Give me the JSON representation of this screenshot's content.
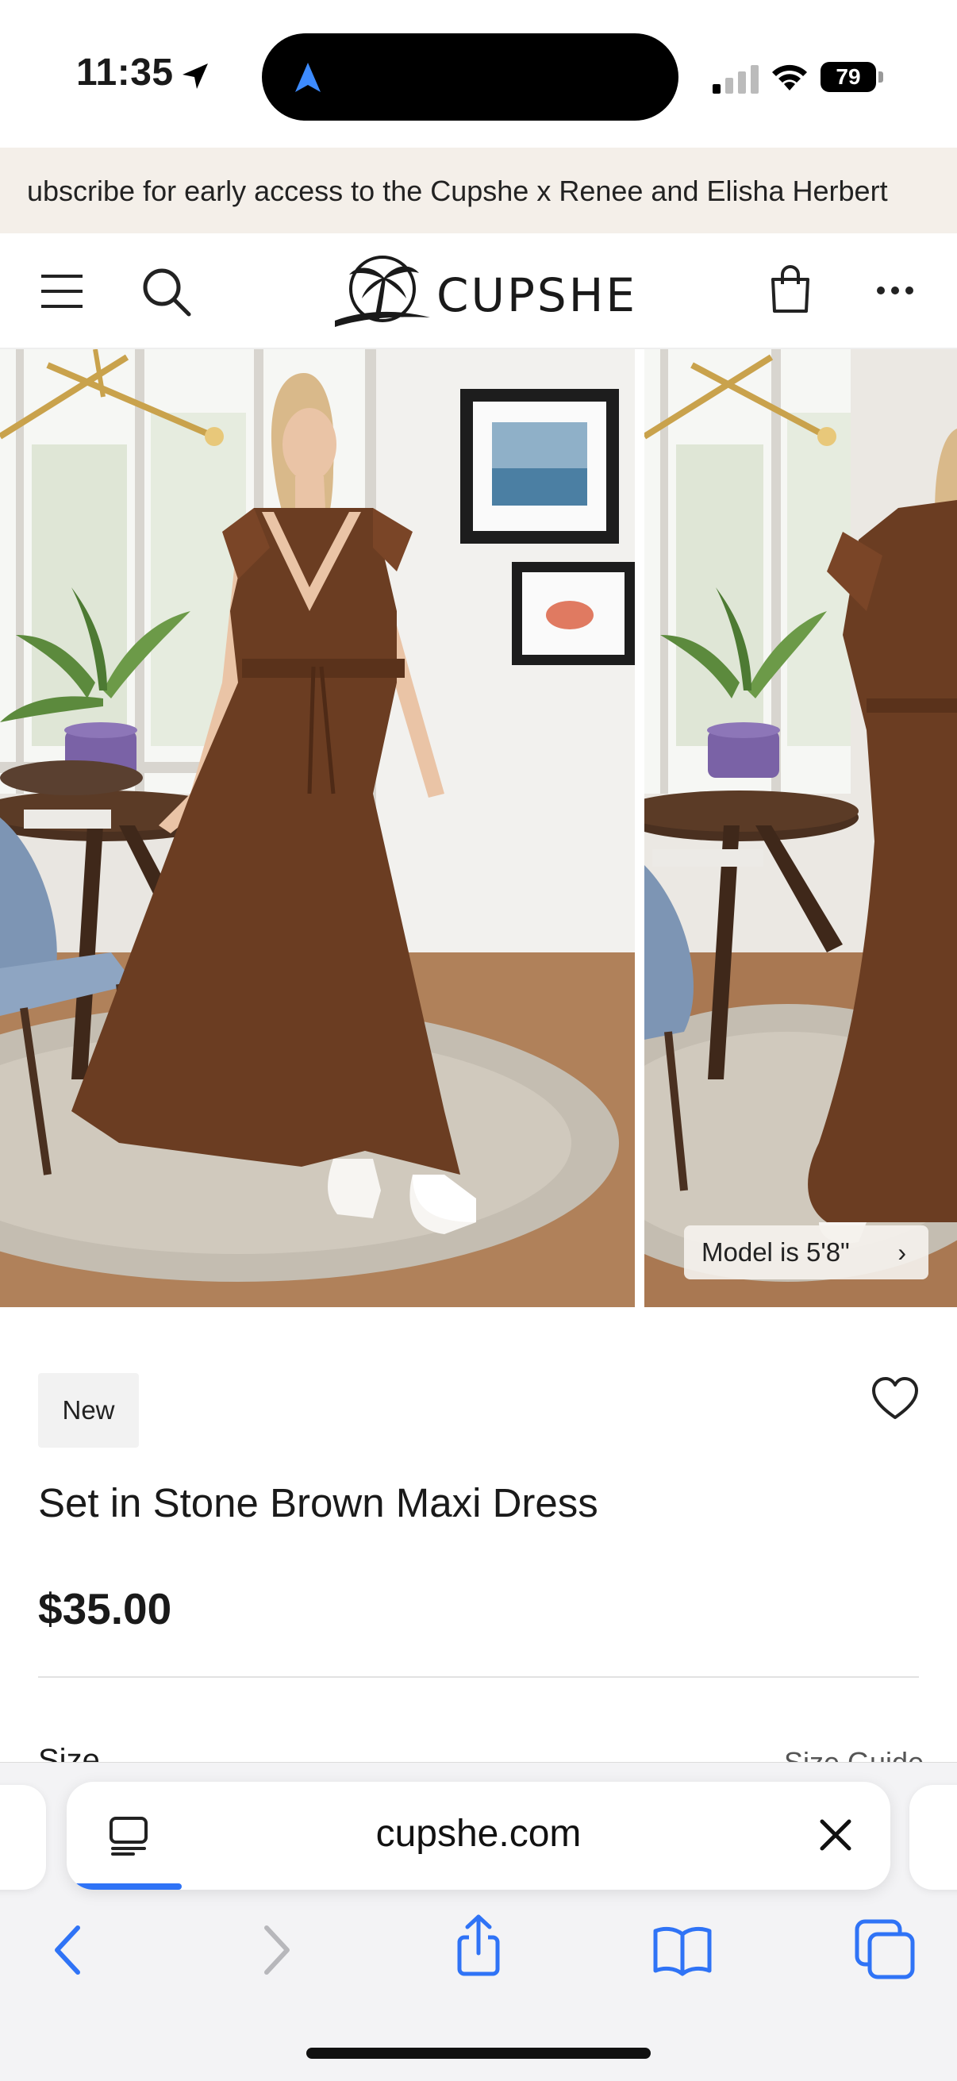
{
  "status_bar": {
    "time": "11:35",
    "battery": "79"
  },
  "announcement": {
    "text": "ubscribe for early access to the Cupshe x Renee and Elisha Herbert"
  },
  "header": {
    "brand": "CUPSHE"
  },
  "gallery": {
    "model_chip": "Model is 5'8\"",
    "progress_fraction": 0.125
  },
  "product": {
    "badge": "New",
    "title": "Set in Stone Brown Maxi Dress",
    "price": "$35.00",
    "size_label": "Size",
    "size_guide": "Size Guide"
  },
  "browser": {
    "url": "cupshe.com",
    "load_progress": 0.14
  },
  "colors": {
    "dress_brown": "#6b3d22",
    "announcement_bg": "#f4efe9",
    "safari_blue": "#2f73f6"
  },
  "icons": {
    "status": [
      "location-arrow-icon",
      "cellular-signal-icon",
      "wifi-icon",
      "battery-icon"
    ],
    "header": [
      "hamburger-menu-icon",
      "search-icon",
      "shopping-bag-icon",
      "more-dots-icon"
    ],
    "product": [
      "heart-icon"
    ],
    "browser": [
      "reader-mode-icon",
      "close-icon",
      "back-chevron-icon",
      "forward-chevron-icon",
      "share-icon",
      "bookmarks-icon",
      "tabs-icon"
    ]
  }
}
